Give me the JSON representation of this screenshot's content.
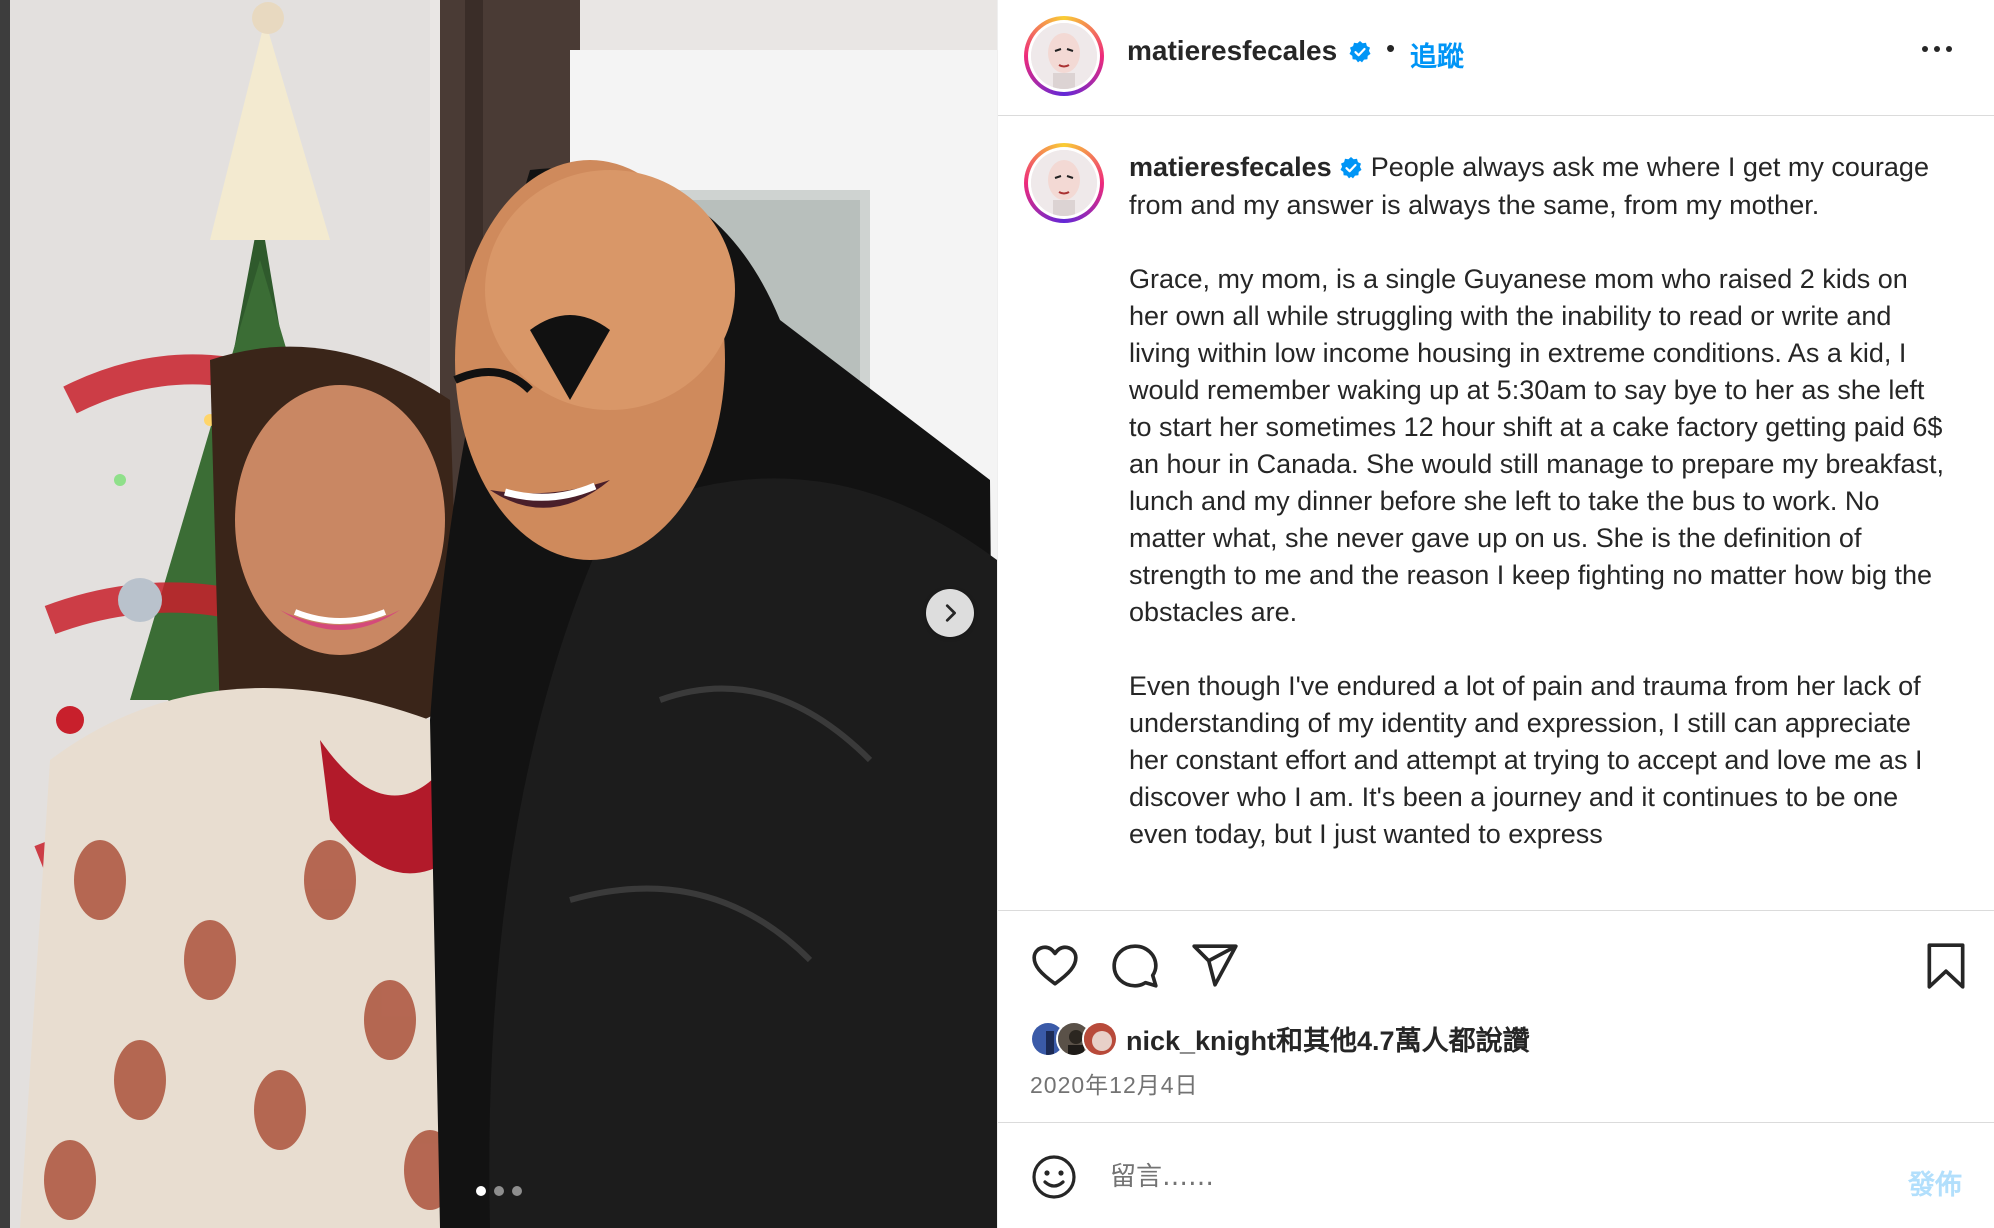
{
  "post": {
    "username": "matieresfecales",
    "verified": true,
    "follow_label": "追蹤",
    "separator": "•"
  },
  "caption": {
    "username": "matieresfecales",
    "paragraphs": [
      "People always ask me where I get my courage from and my answer is always the same, from my mother.",
      "Grace, my mom, is a single Guyanese mom who raised 2 kids on her own all while struggling with the inability to read or write and living within low income housing in extreme conditions. As a kid, I would remember waking up at 5:30am to say bye to her as she left to start her sometimes 12 hour shift at a cake factory getting paid 6$ an hour in Canada. She would still manage to prepare my breakfast, lunch and my dinner before she left to take the bus to work. No matter what, she never gave up on us. She is the definition of strength to me and the reason I keep fighting no matter how big the obstacles are.",
      "Even though I've endured a lot of pain and trauma from her lack of understanding of my identity and expression, I still can appreciate her constant effort and attempt at trying to accept and love me as I discover who I am. It's been a journey and it continues to be one even today, but I just wanted to express"
    ]
  },
  "engagement": {
    "likes_text": "nick_knight和其他4.7萬人都說讚",
    "date": "2020年12月4日"
  },
  "carousel": {
    "total": 3,
    "current": 1
  },
  "comment": {
    "placeholder": "留言……",
    "post_label": "發佈"
  },
  "icons": {
    "like": "heart-icon",
    "comment": "comment-bubble-icon",
    "share": "paper-plane-icon",
    "save": "bookmark-icon",
    "emoji": "smiley-icon",
    "next": "chevron-right-icon",
    "more": "ellipsis-icon",
    "verified": "verified-badge-icon"
  },
  "colors": {
    "accent": "#0095f6",
    "post_disabled": "#b2dffc",
    "text": "#262626",
    "muted": "#737373"
  }
}
